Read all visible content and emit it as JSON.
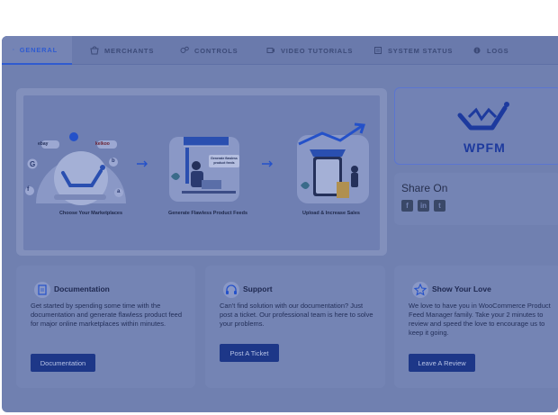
{
  "tabs": [
    {
      "label": "General",
      "icon": "gear-icon",
      "active": true
    },
    {
      "label": "Merchants",
      "icon": "shop-icon"
    },
    {
      "label": "Controls",
      "icon": "controls-icon"
    },
    {
      "label": "Video Tutorials",
      "icon": "video-icon"
    },
    {
      "label": "System Status",
      "icon": "status-icon"
    },
    {
      "label": "Logs",
      "icon": "info-icon"
    }
  ],
  "hero": {
    "steps": [
      {
        "label": "Choose Your Marketplaces"
      },
      {
        "label": "Generate Flawless Product Feeds"
      },
      {
        "label": "Upload & Increase Sales"
      }
    ],
    "badges": [
      "ebay",
      "kelkoo",
      "G",
      "f",
      "b",
      "a"
    ],
    "bubble": "Generate flawless product feeds"
  },
  "logo": {
    "text": "WPFM"
  },
  "share": {
    "title": "Share On",
    "icons": [
      "facebook-icon",
      "linkedin-icon",
      "twitter-icon"
    ]
  },
  "cards": [
    {
      "title": "Documentation",
      "icon": "document-icon",
      "text": "Get started by spending some time with the documentation and generate flawless product feed for major online marketplaces within minutes.",
      "button": "Documentation"
    },
    {
      "title": "Support",
      "icon": "headset-icon",
      "text": "Can't find solution with our documentation? Just post a ticket. Our professional team is here to solve your problems.",
      "button": "Post A Ticket"
    },
    {
      "title": "Show Your Love",
      "icon": "star-icon",
      "text": "We love to have you in WooCommerce Product Feed Manager family. Take your 2 minutes to review and speed the love to encourage us to keep it going.",
      "button": "Leave A Review"
    }
  ]
}
